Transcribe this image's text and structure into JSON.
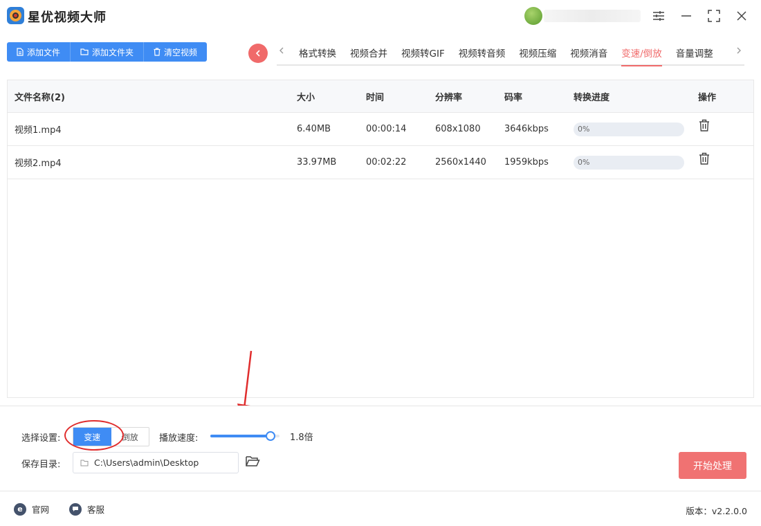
{
  "app": {
    "title": "星优视频大师"
  },
  "toolbar": {
    "add_file": "添加文件",
    "add_folder": "添加文件夹",
    "clear": "清空视频"
  },
  "tabs": [
    {
      "label": "格式转换"
    },
    {
      "label": "视频合并"
    },
    {
      "label": "视频转GIF"
    },
    {
      "label": "视频转音频"
    },
    {
      "label": "视频压缩"
    },
    {
      "label": "视频消音"
    },
    {
      "label": "变速/倒放",
      "active": true
    },
    {
      "label": "音量调整"
    }
  ],
  "table": {
    "headers": {
      "name": "文件名称(2)",
      "size": "大小",
      "time": "时间",
      "resolution": "分辨率",
      "bitrate": "码率",
      "progress": "转换进度",
      "action": "操作"
    },
    "rows": [
      {
        "name": "视频1.mp4",
        "size": "6.40MB",
        "time": "00:00:14",
        "resolution": "608x1080",
        "bitrate": "3646kbps",
        "progress": "0%"
      },
      {
        "name": "视频2.mp4",
        "size": "33.97MB",
        "time": "00:02:22",
        "resolution": "2560x1440",
        "bitrate": "1959kbps",
        "progress": "0%"
      }
    ]
  },
  "settings": {
    "mode_label": "选择设置:",
    "mode_speed": "变速",
    "mode_reverse": "倒放",
    "speed_label": "播放速度:",
    "speed_value": "1.8倍",
    "speed_fraction": 0.87,
    "dir_label": "保存目录:",
    "dir_value": "C:\\Users\\admin\\Desktop",
    "start": "开始处理"
  },
  "footer": {
    "website": "官网",
    "support": "客服",
    "version": "版本：v2.2.0.0"
  },
  "colors": {
    "primary": "#3f8cf4",
    "accent": "#f06a6a",
    "annotation": "#e02d2d"
  }
}
